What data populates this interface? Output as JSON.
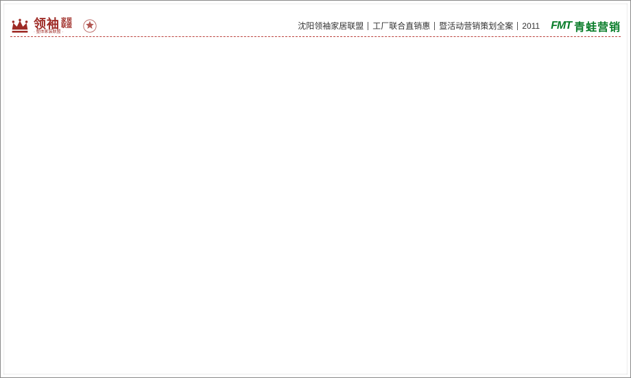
{
  "header": {
    "logo_main": "领袖",
    "logo_side": "家居\n联盟",
    "logo_sub": "· 整体家装联盟 ·",
    "tags": [
      "沈阳领袖家居联盟",
      "工厂联合直销惠",
      "暨活动营销策划全案",
      "2011"
    ],
    "right_logo_en": "FMT",
    "right_logo_cn": "青蛙营销"
  }
}
